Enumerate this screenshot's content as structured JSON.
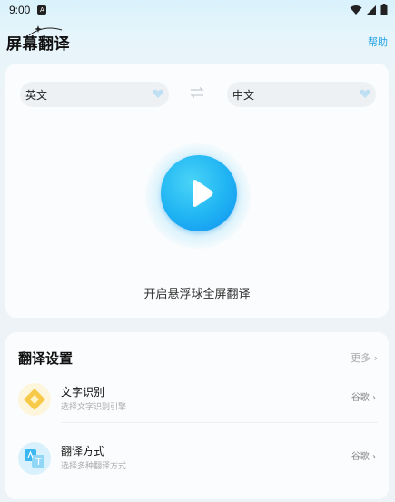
{
  "status_bar": {
    "time": "9:00",
    "notification_glyph": "A"
  },
  "header": {
    "title": "屏幕翻译",
    "help_label": "帮助"
  },
  "translator": {
    "source_language": "英文",
    "target_language": "中文",
    "floating_ball_label": "开启悬浮球全屏翻译"
  },
  "settings": {
    "section_title": "翻译设置",
    "more_label": "更多",
    "items": [
      {
        "title": "文字识别",
        "subtitle": "选择文字识别引擎",
        "value": "谷歌",
        "icon": "ocr-diamond-icon"
      },
      {
        "title": "翻译方式",
        "subtitle": "选择多种翻译方式",
        "value": "谷歌",
        "icon": "translate-icon"
      }
    ]
  },
  "colors": {
    "accent": "#23a0e6",
    "play_button": "#22b6f3"
  }
}
